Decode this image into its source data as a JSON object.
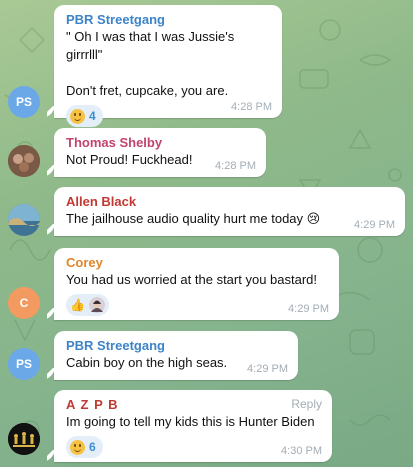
{
  "messages": [
    {
      "sender": "PBR Streetgang",
      "sender_color": "#3c83c8",
      "avatar": {
        "initials": "PS",
        "color": "#6aa8e8"
      },
      "text": "\" Oh I was that I was Jussie's girrrlll\"\n\nDon't fret, cupcake, you are.",
      "time": "4:28 PM",
      "reaction": {
        "emoji": "grinning-face",
        "count": "4"
      }
    },
    {
      "sender": "Thomas Shelby",
      "sender_color": "#c24270",
      "avatar": {
        "initials": "",
        "color": "#6b4b3c"
      },
      "text": "Not Proud! Fuckhead!",
      "time": "4:28 PM"
    },
    {
      "sender": "Allen Black",
      "sender_color": "#c03a33",
      "avatar": {
        "initials": "",
        "color": "#4c89a8"
      },
      "text": "The jailhouse audio quality hurt me today 😢",
      "time": "4:29 PM"
    },
    {
      "sender": "Corey",
      "sender_color": "#e0862c",
      "avatar": {
        "initials": "C",
        "color": "#f29a5f"
      },
      "text": "You had us worried at the start you bastard!",
      "time": "4:29 PM",
      "reaction": {
        "emoji": "thumbs-up",
        "count": ""
      }
    },
    {
      "sender": "PBR Streetgang",
      "sender_color": "#3c83c8",
      "avatar": {
        "initials": "PS",
        "color": "#6aa8e8"
      },
      "text": "Cabin boy on the high seas.",
      "time": "4:29 PM"
    },
    {
      "sender": "A Z P B",
      "sender_color": "#c03a33",
      "avatar": {
        "initials": "",
        "color": "#111111"
      },
      "text": "Im going to tell my kids this is Hunter Biden",
      "time": "4:30 PM",
      "reply_label": "Reply",
      "reaction": {
        "emoji": "grinning-face",
        "count": "6"
      }
    }
  ]
}
